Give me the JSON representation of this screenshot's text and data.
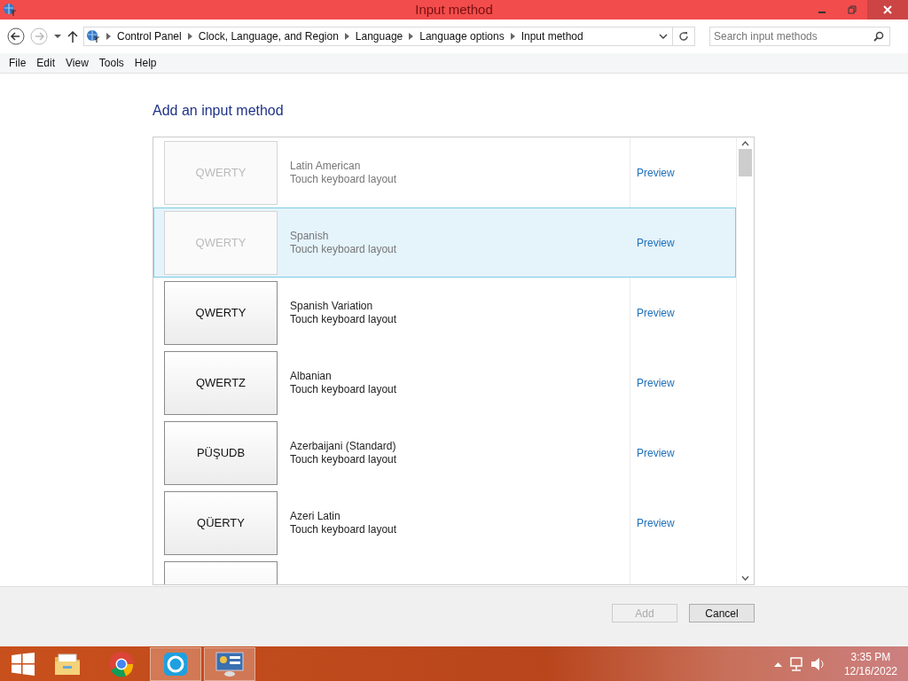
{
  "window": {
    "title": "Input method"
  },
  "address_bar": {
    "breadcrumbs": [
      "Control Panel",
      "Clock, Language, and Region",
      "Language",
      "Language options",
      "Input method"
    ],
    "search": {
      "placeholder": "Search input methods"
    }
  },
  "menu": [
    "File",
    "Edit",
    "View",
    "Tools",
    "Help"
  ],
  "heading": "Add an input method",
  "input_methods": [
    {
      "key_label": "QWERTY",
      "name": "Latin American",
      "description": "Touch keyboard layout",
      "link": "Preview",
      "disabled": true,
      "selected": false
    },
    {
      "key_label": "QWERTY",
      "name": "Spanish",
      "description": "Touch keyboard layout",
      "link": "Preview",
      "disabled": true,
      "selected": true
    },
    {
      "key_label": "QWERTY",
      "name": "Spanish Variation",
      "description": "Touch keyboard layout",
      "link": "Preview",
      "disabled": false,
      "selected": false
    },
    {
      "key_label": "QWERTZ",
      "name": "Albanian",
      "description": "Touch keyboard layout",
      "link": "Preview",
      "disabled": false,
      "selected": false
    },
    {
      "key_label": "PÜŞUDB",
      "name": "Azerbaijani (Standard)",
      "description": "Touch keyboard layout",
      "link": "Preview",
      "disabled": false,
      "selected": false
    },
    {
      "key_label": "QÜERTY",
      "name": "Azeri Latin",
      "description": "Touch keyboard layout",
      "link": "Preview",
      "disabled": false,
      "selected": false
    }
  ],
  "buttons": [
    {
      "label": "Add",
      "disabled": true
    },
    {
      "label": "Cancel",
      "disabled": false
    }
  ],
  "taskbar": {
    "time": "3:35 PM",
    "date": "12/16/2022"
  }
}
